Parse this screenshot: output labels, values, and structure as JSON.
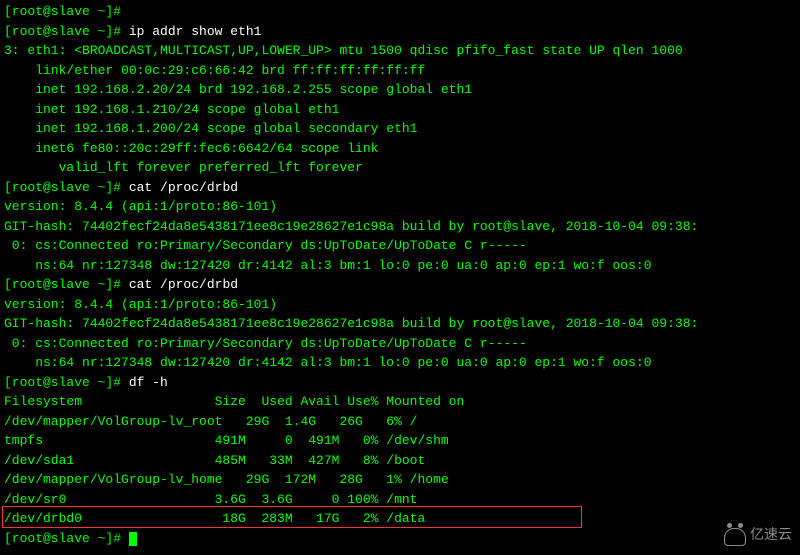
{
  "prompt_user": "root",
  "prompt_host": "slave",
  "prompt_path": "~",
  "prompt_symbol": "#",
  "commands": {
    "ip_addr": "ip addr show eth1",
    "cat_drbd": "cat /proc/drbd",
    "df_h": "df -h"
  },
  "ip_output": {
    "header": "3: eth1: <BROADCAST,MULTICAST,UP,LOWER_UP> mtu 1500 qdisc pfifo_fast state UP qlen 1000",
    "link_ether": "    link/ether 00:0c:29:c6:66:42 brd ff:ff:ff:ff:ff:ff",
    "inet1": "    inet 192.168.2.20/24 brd 192.168.2.255 scope global eth1",
    "inet2": "    inet 192.168.1.210/24 scope global eth1",
    "inet3": "    inet 192.168.1.200/24 scope global secondary eth1",
    "inet6": "    inet6 fe80::20c:29ff:fec6:6642/64 scope link",
    "valid": "       valid_lft forever preferred_lft forever"
  },
  "drbd_output": {
    "version": "version: 8.4.4 (api:1/proto:86-101)",
    "git_hash": "GIT-hash: 74402fecf24da8e5438171ee8c19e28627e1c98a build by root@slave, 2018-10-04 09:38:",
    "conn": " 0: cs:Connected ro:Primary/Secondary ds:UpToDate/UpToDate C r-----",
    "stats": "    ns:64 nr:127348 dw:127420 dr:4142 al:3 bm:1 lo:0 pe:0 ua:0 ap:0 ep:1 wo:f oos:0"
  },
  "df_output": {
    "header": "Filesystem                 Size  Used Avail Use% Mounted on",
    "rows": [
      "/dev/mapper/VolGroup-lv_root   29G  1.4G   26G   6% /",
      "tmpfs                      491M     0  491M   0% /dev/shm",
      "/dev/sda1                  485M   33M  427M   8% /boot",
      "/dev/mapper/VolGroup-lv_home   29G  172M   28G   1% /home",
      "/dev/sr0                   3.6G  3.6G     0 100% /mnt",
      "/dev/drbd0                  18G  283M   17G   2% /data"
    ]
  },
  "watermark": "亿速云",
  "top_partial": "[root@slave ~]#"
}
